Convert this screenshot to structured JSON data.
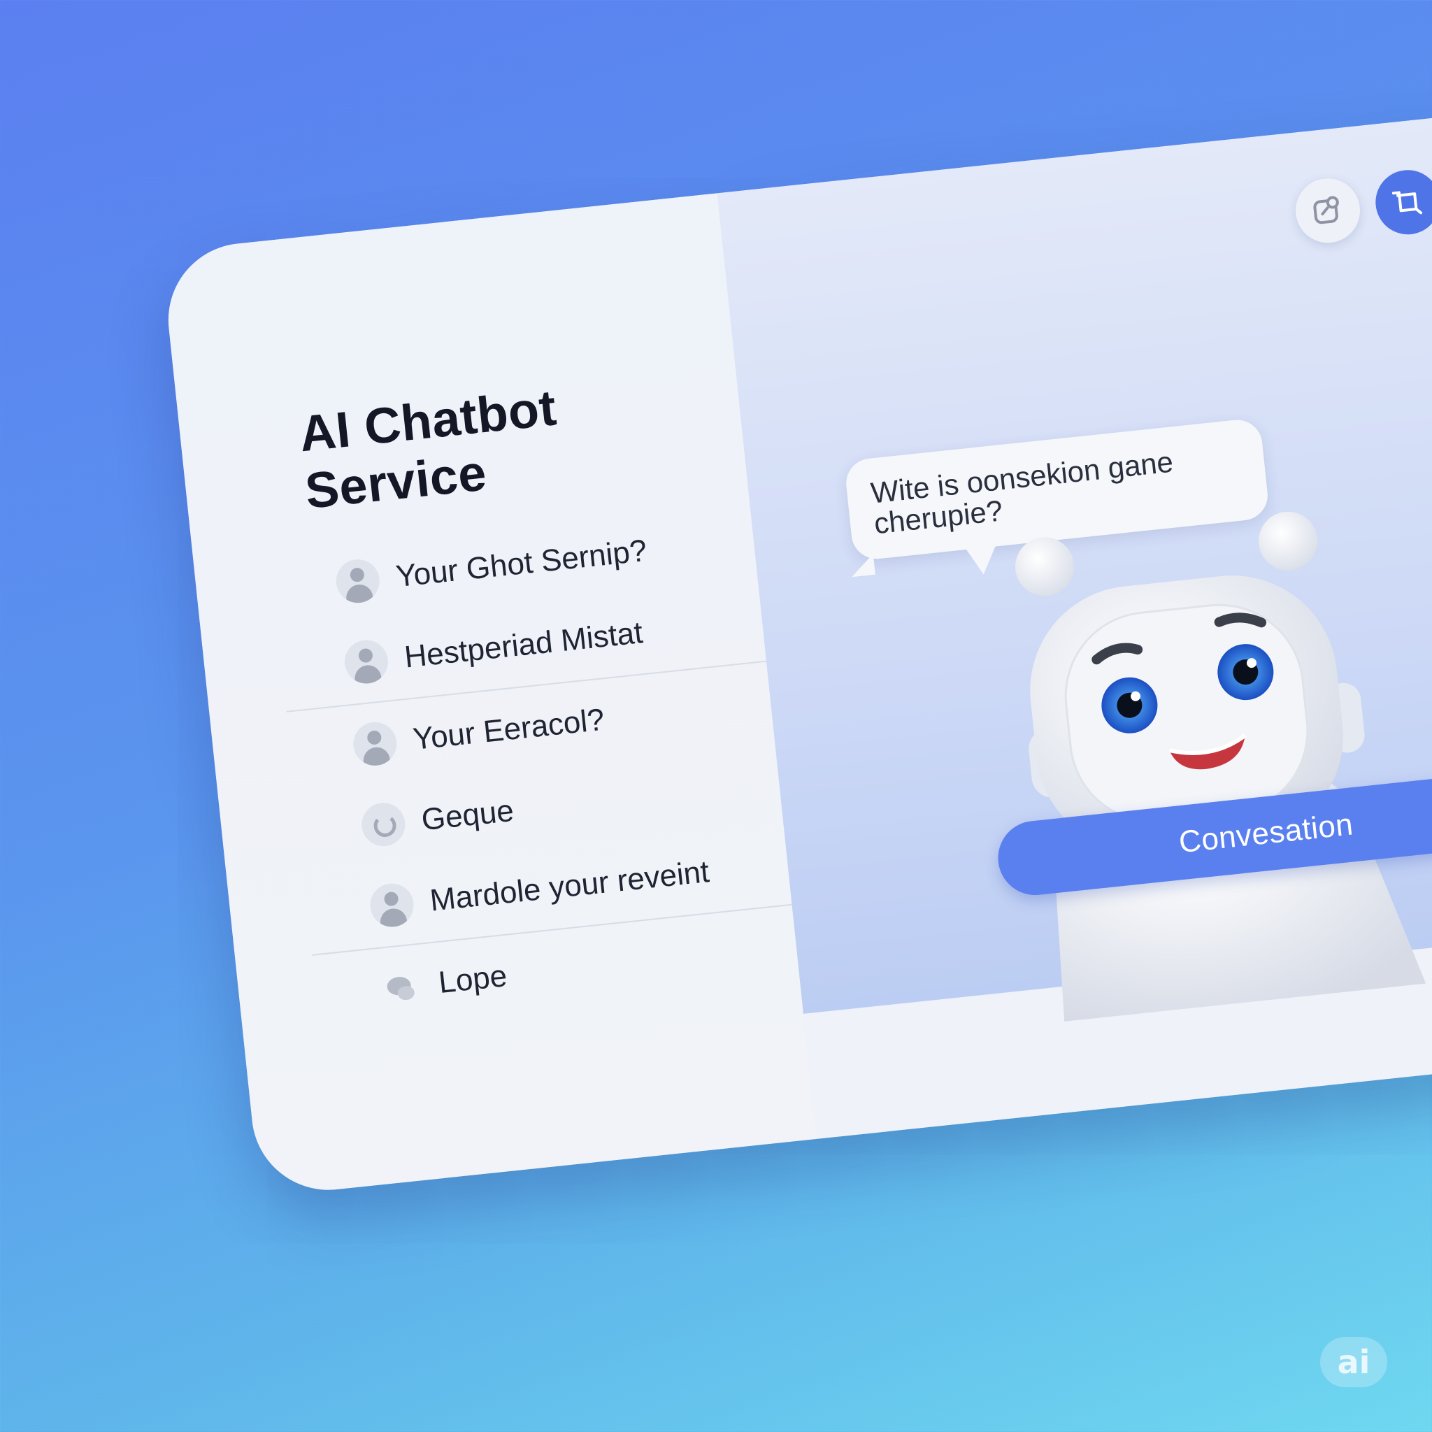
{
  "app": {
    "title": "AI Chatbot Service"
  },
  "sidebar": {
    "items": [
      {
        "label": "Your Ghot Sernip?",
        "icon": "user-icon"
      },
      {
        "label": "Hestperiad Mistat",
        "icon": "user-icon"
      },
      {
        "label": "Your Eeracol?",
        "icon": "user-icon"
      },
      {
        "label": "Geque",
        "icon": "refresh-icon"
      },
      {
        "label": "Mardole your reveint",
        "icon": "user-icon"
      },
      {
        "label": "Lope",
        "icon": "cloud-icon"
      }
    ]
  },
  "chat": {
    "bot_message": "Wite is oonsekion gane cherupie?",
    "primary_button": "Convesation"
  },
  "toolbar": {
    "icons": [
      "share-icon",
      "crop-icon"
    ]
  },
  "badge": {
    "label": "ai"
  },
  "colors": {
    "accent": "#5a80f0",
    "accent_dark": "#4f74e8",
    "background_top": "#5b7ff0",
    "background_bottom": "#6fd8f0"
  }
}
